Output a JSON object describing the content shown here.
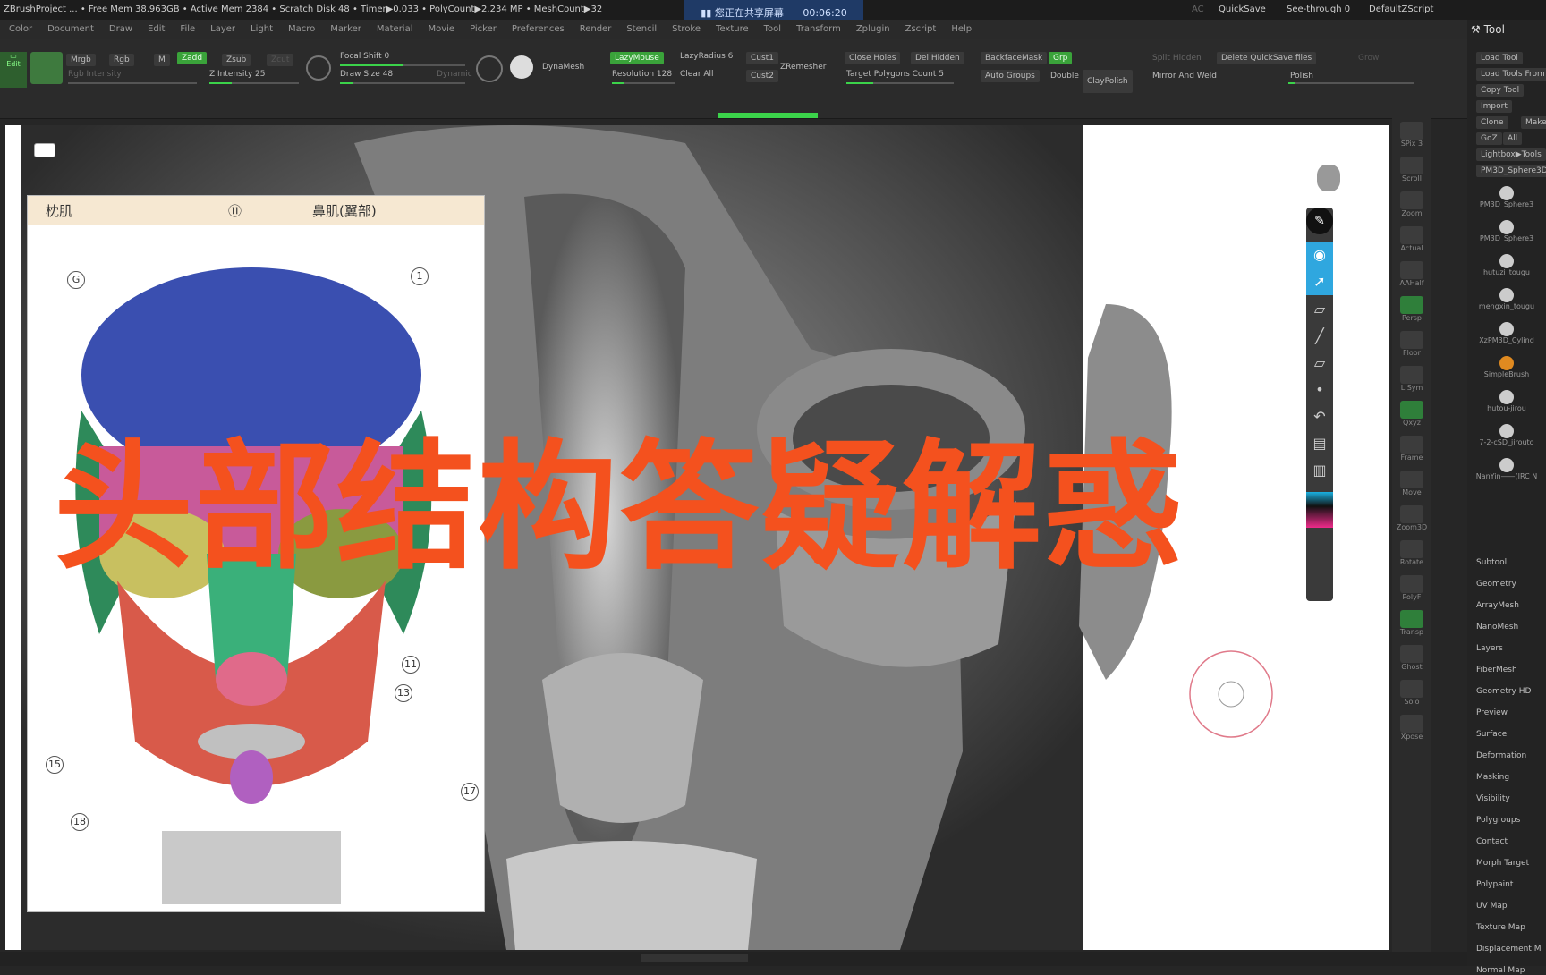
{
  "titlebar": {
    "text": "ZBrushProject   ...  • Free Mem 38.963GB • Active Mem 2384 • Scratch Disk 48 •  Timer▶0.033 • PolyCount▶2.234 MP  • MeshCount▶32",
    "right_ac": "AC",
    "quicksave": "QuickSave",
    "seethrough": "See-through  0",
    "default_zscript": "DefaultZScript"
  },
  "share_banner": {
    "text": "您正在共享屏幕",
    "time": "00:06:20"
  },
  "menu": [
    "Color",
    "Document",
    "Draw",
    "Edit",
    "File",
    "Layer",
    "Light",
    "Macro",
    "Marker",
    "Material",
    "Movie",
    "Picker",
    "Preferences",
    "Render",
    "Stencil",
    "Stroke",
    "Texture",
    "Tool",
    "Transform",
    "Zplugin",
    "Zscript",
    "Help"
  ],
  "shelf": {
    "edit": "Edit",
    "mrgb": "Mrgb",
    "rgb": "Rgb",
    "m": "M",
    "zadd": "Zadd",
    "zsub": "Zsub",
    "zcut": "Zcut",
    "rgb_intensity": "Rgb Intensity",
    "z_intensity": "Z Intensity 25",
    "focal_shift": "Focal Shift 0",
    "draw_size": "Draw Size 48",
    "dynamic": "Dynamic",
    "dynamesh": "DynaMesh",
    "lazymouse": "LazyMouse",
    "lazyradius": "LazyRadius 6",
    "resolution": "Resolution 128",
    "clear_all": "Clear All",
    "cust1": "Cust1",
    "cust2": "Cust2",
    "zremesher": "ZRemesher",
    "close_holes": "Close Holes",
    "del_hidden": "Del Hidden",
    "target_polycount": "Target Polygons Count 5",
    "backface_mask": "BackfaceMask",
    "grp": "Grp",
    "auto_groups": "Auto Groups",
    "double": "Double",
    "claypolish": "ClayPolish",
    "split_hidden": "Split Hidden",
    "delete_quicksave": "Delete QuickSave files",
    "grow": "Grow",
    "mirror_weld": "Mirror And Weld",
    "polish": "Polish"
  },
  "ref_card": {
    "left_label": "枕肌",
    "circle": "⑪",
    "right_label": "鼻肌(翼部)",
    "markers": [
      "G",
      "1",
      "11",
      "13",
      "15",
      "17",
      "18"
    ]
  },
  "overlay_title": "头部结构答疑解惑",
  "right_shelf": [
    "SPix 3",
    "Scroll",
    "Zoom",
    "Actual",
    "AAHalf",
    "Persp",
    "Floor",
    "L.Sym",
    "Qxyz",
    "Frame",
    "Move",
    "Zoom3D",
    "Rotate",
    "PolyF",
    "Transp",
    "Ghost",
    "Solo",
    "Xpose"
  ],
  "tool_panel": {
    "header": "Tool",
    "buttons": [
      "Load Tool",
      "Load Tools From",
      "Copy Tool",
      "Import",
      "Clone",
      "Make Po",
      "GoZ",
      "All",
      "Lightbox▶Tools",
      "PM3D_Sphere3D"
    ],
    "thumbs": [
      "PM3D_Sphere3",
      "PM3D_Sphere3",
      "hutuzi_tougu",
      "mengxin_tougu",
      "XzPM3D_Cylind",
      "SimpleBrush",
      "hutou-jirou",
      "7-2-cSD_jirouto",
      "NanYin——(IRC N"
    ],
    "subpalettes": [
      "Subtool",
      "Geometry",
      "ArrayMesh",
      "NanoMesh",
      "Layers",
      "FiberMesh",
      "Geometry HD",
      "Preview",
      "Surface",
      "Deformation",
      "Masking",
      "Visibility",
      "Polygroups",
      "Contact",
      "Morph Target",
      "Polypaint",
      "UV Map",
      "Texture Map",
      "Displacement M",
      "Normal Map"
    ]
  }
}
